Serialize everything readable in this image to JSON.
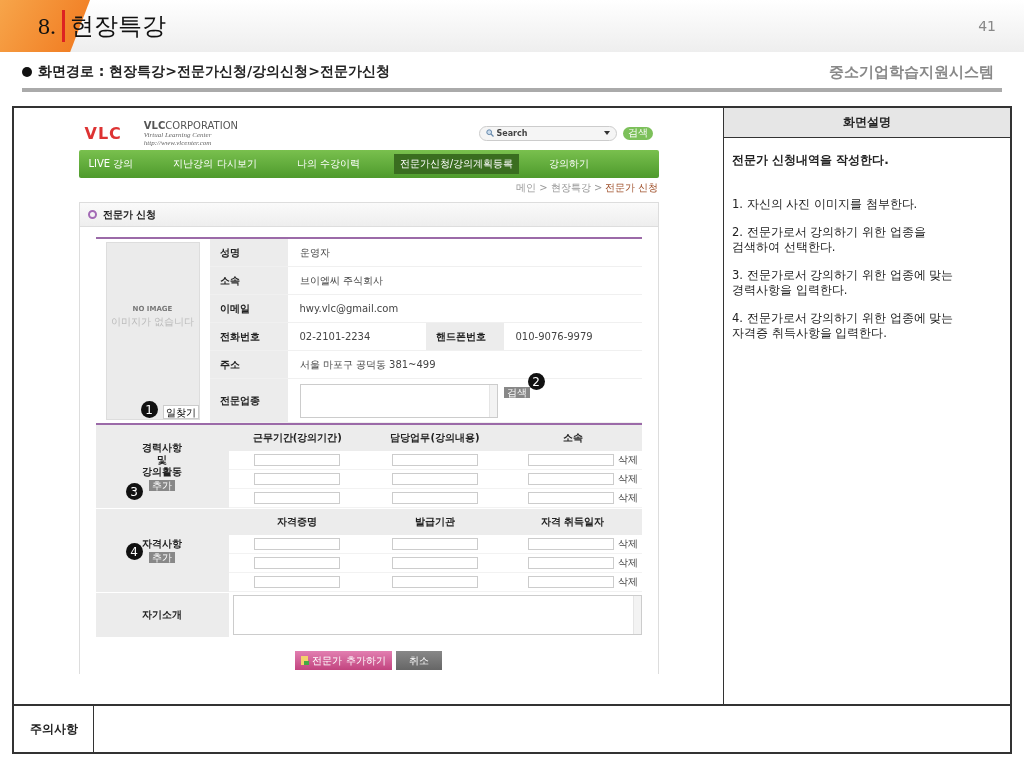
{
  "header": {
    "number": "8.",
    "title": "현장특강",
    "page": "41"
  },
  "path": "화면경로 : 현장특강>전문가신청/강의신청>전문가신청",
  "system_name": "중소기업학습지원시스템",
  "screen": {
    "logo": {
      "mark": "VLC",
      "name_bold": "VLC",
      "name_light": "CORPORATION",
      "tagline": "Virtual Learning Center",
      "url": "http://www.vlcenter.com"
    },
    "search": {
      "placeholder": "Search",
      "button": "검색"
    },
    "nav": [
      {
        "label": "LIVE 강의",
        "selected": false
      },
      {
        "label": "지난강의 다시보기",
        "selected": false
      },
      {
        "label": "나의 수강이력",
        "selected": false
      },
      {
        "label": "전문가신청/강의계획등록",
        "selected": true
      },
      {
        "label": "강의하기",
        "selected": false
      }
    ],
    "breadcrumb": {
      "trail": "메인 > 현장특강 >",
      "current": "전문가 신청"
    },
    "panel_title": "전문가 신청",
    "photo": {
      "title": "NO IMAGE",
      "subtitle": "이미지가 없습니다",
      "button": "일찾기",
      "marker": "1"
    },
    "info": [
      {
        "label": "성명",
        "value": "운영자"
      },
      {
        "label": "소속",
        "value": "브이엘씨 주식회사"
      },
      {
        "label": "이메일",
        "value": "hwy.vlc@gmail.com"
      },
      {
        "label": "전화번호",
        "value": "02-2101-2234",
        "label2": "핸드폰번호",
        "value2": "010-9076-9979"
      },
      {
        "label": "주소",
        "value": "서울 마포구 공덕동 381~499"
      }
    ],
    "industry": {
      "label": "전문업종",
      "button": "검색",
      "marker": "2"
    },
    "career": {
      "label": "경력사항\n및\n강의활동",
      "button": "추가",
      "marker": "3",
      "columns": [
        "근무기간(강의기간)",
        "담당업무(강의내용)",
        "소속"
      ],
      "rows": [
        {
          "delete": "삭제"
        },
        {
          "delete": "삭제"
        },
        {
          "delete": "삭제"
        }
      ]
    },
    "certificates": {
      "label": "자격사항",
      "button": "추가",
      "marker": "4",
      "columns": [
        "자격증명",
        "발급기관",
        "자격 취득일자"
      ],
      "rows": [
        {
          "delete": "삭제"
        },
        {
          "delete": "삭제"
        },
        {
          "delete": "삭제"
        }
      ]
    },
    "intro": {
      "label": "자기소개"
    },
    "buttons": [
      {
        "label": "전문가 추가하기",
        "kind": "primary"
      },
      {
        "label": "취소",
        "kind": "secondary"
      }
    ]
  },
  "description": {
    "title": "화면설명",
    "lead": "전문가 신청내역을 작성한다.",
    "items": [
      "1. 자신의 사진 이미지를 첨부한다.",
      "2. 전문가로서 강의하기 위한 업종을\n검색하여 선택한다.",
      "3. 전문가로서 강의하기 위한 업종에 맞는\n경력사항을 입력한다.",
      "4. 전문가로서 강의하기 위한 업종에 맞는\n자격증 취득사항을 입력한다."
    ]
  },
  "notes": {
    "label": "주의사항"
  }
}
